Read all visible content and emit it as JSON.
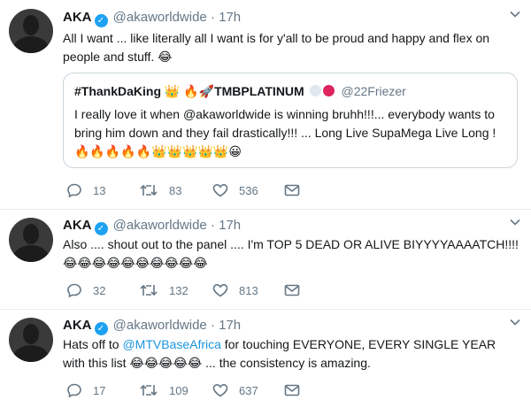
{
  "tweets": [
    {
      "name": "AKA",
      "handle": "@akaworldwide",
      "dot": "·",
      "time": "17h",
      "text": "All I want ... like literally all I want is for y'all to be proud and happy and flex on people and stuff. 😂",
      "quote": {
        "name": "#ThankDaKing 👑 🔥🚀TMBPLATINUM",
        "handle": "@22Friezer",
        "text": "I really love it when @akaworldwide is winning bruhh!!!... everybody wants to bring him down and they fail drastically!!! ... Long Live SupaMega Live Long ! 🔥🔥🔥🔥🔥👑👑👑👑👑😀"
      },
      "replies": "13",
      "retweets": "83",
      "likes": "536"
    },
    {
      "name": "AKA",
      "handle": "@akaworldwide",
      "dot": "·",
      "time": "17h",
      "text": "Also .... shout out to the panel .... I'm TOP 5 DEAD OR ALIVE BIYYYYAAAATCH!!!! 😂😂😂😂😂😂😂😂😂😂",
      "replies": "32",
      "retweets": "132",
      "likes": "813"
    },
    {
      "name": "AKA",
      "handle": "@akaworldwide",
      "dot": "·",
      "time": "17h",
      "text_pre": "Hats off to ",
      "mention": "@MTVBaseAfrica",
      "text_post": " for touching EVERYONE, EVERY SINGLE YEAR with this list 😂😂😂😂😂 ... the consistency is amazing.",
      "replies": "17",
      "retweets": "109",
      "likes": "637"
    }
  ],
  "icons": {
    "verified": "✓",
    "chevron": "⌄"
  },
  "colors": {
    "accent": "#1da1f2",
    "link": "#1b95e0",
    "muted": "#657786"
  }
}
